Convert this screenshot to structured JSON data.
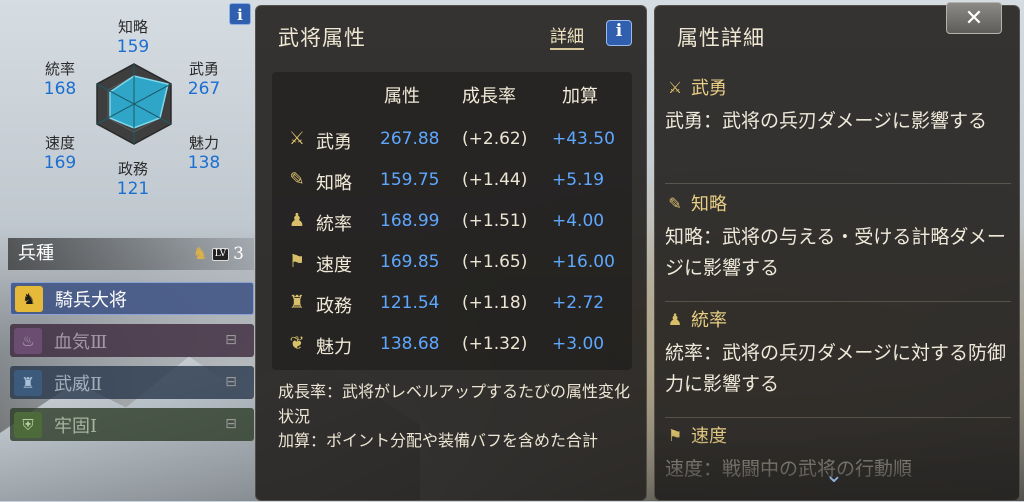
{
  "left": {
    "stats": {
      "chiryaku": {
        "label": "知略",
        "value": "159"
      },
      "tosotsu": {
        "label": "統率",
        "value": "168"
      },
      "buyu": {
        "label": "武勇",
        "value": "267"
      },
      "sokudo": {
        "label": "速度",
        "value": "169"
      },
      "miryoku": {
        "label": "魅力",
        "value": "138"
      },
      "seimu": {
        "label": "政務",
        "value": "121"
      }
    },
    "troop_header": "兵種",
    "troop_level": "3",
    "troop_level_badge": "LV",
    "troops": [
      {
        "name": "騎兵大将",
        "icon": "horse-icon"
      },
      {
        "name": "血気Ⅲ",
        "icon": "flame-icon"
      },
      {
        "name": "武威Ⅱ",
        "icon": "statue-icon"
      },
      {
        "name": "牢固Ⅰ",
        "icon": "shield-icon"
      }
    ],
    "info_label": "i"
  },
  "attr_panel": {
    "title": "武将属性",
    "detail_link": "詳細",
    "info_label": "i",
    "headers": {
      "attr": "属性",
      "growth": "成長率",
      "bonus": "加算"
    },
    "rows": [
      {
        "name": "武勇",
        "value": "267.88",
        "growth": "(+2.62)",
        "bonus": "+43.50",
        "icon": "crossed-swords-icon"
      },
      {
        "name": "知略",
        "value": "159.75",
        "growth": "(+1.44)",
        "bonus": "+5.19",
        "icon": "fan-icon"
      },
      {
        "name": "統率",
        "value": "168.99",
        "growth": "(+1.51)",
        "bonus": "+4.00",
        "icon": "troops-icon"
      },
      {
        "name": "速度",
        "value": "169.85",
        "growth": "(+1.65)",
        "bonus": "+16.00",
        "icon": "runner-icon"
      },
      {
        "name": "政務",
        "value": "121.54",
        "growth": "(+1.18)",
        "bonus": "+2.72",
        "icon": "castle-icon"
      },
      {
        "name": "魅力",
        "value": "138.68",
        "growth": "(+1.32)",
        "bonus": "+3.00",
        "icon": "charm-icon"
      }
    ],
    "notes": [
      "成長率：武将がレベルアップするたびの属性変化状況",
      "加算：ポイント分配や装備バフを含めた合計"
    ]
  },
  "detail_panel": {
    "title": "属性詳細",
    "close_label": "✕",
    "sections": [
      {
        "name": "武勇",
        "icon": "crossed-swords-icon",
        "desc": "武勇：武将の兵刃ダメージに影響する"
      },
      {
        "name": "知略",
        "icon": "fan-icon",
        "desc": "知略：武将の与える・受ける計略ダメージに影響する"
      },
      {
        "name": "統率",
        "icon": "troops-icon",
        "desc": "統率：武将の兵刃ダメージに対する防御力に影響する"
      },
      {
        "name": "速度",
        "icon": "runner-icon",
        "desc": "速度：戦闘中の武将の行動順"
      }
    ]
  },
  "colors": {
    "accent_blue": "#5ea7ff",
    "gold": "#e8cf84",
    "panel_bg": "#282624"
  }
}
